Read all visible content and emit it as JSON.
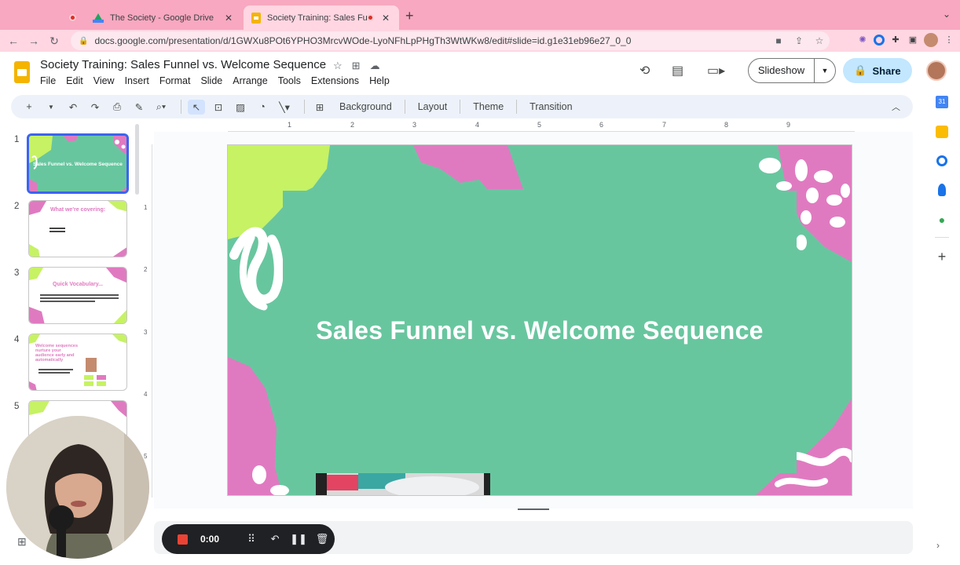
{
  "browser": {
    "tabs": [
      {
        "title": "The Society - Google Drive",
        "icon": "google-drive-icon"
      },
      {
        "title": "Society Training: Sales Fun",
        "icon": "google-slides-icon"
      }
    ],
    "url": "docs.google.com/presentation/d/1GWXu8POt6YPHO3MrcvWOde-LyoNFhLpPHgTh3WtWKw8/edit#slide=id.g1e31eb96e27_0_0"
  },
  "doc": {
    "title": "Society Training: Sales Funnel vs. Welcome Sequence"
  },
  "menu": [
    "File",
    "Edit",
    "View",
    "Insert",
    "Format",
    "Slide",
    "Arrange",
    "Tools",
    "Extensions",
    "Help"
  ],
  "header": {
    "slideshow_label": "Slideshow",
    "share_label": "Share"
  },
  "toolbar": {
    "background_label": "Background",
    "layout_label": "Layout",
    "theme_label": "Theme",
    "transition_label": "Transition"
  },
  "filmstrip": {
    "slides": [
      {
        "number": "1",
        "title": "Sales Funnel vs. Welcome Sequence"
      },
      {
        "number": "2",
        "title": "What we're covering:"
      },
      {
        "number": "3",
        "title": "Quick Vocabulary..."
      },
      {
        "number": "4",
        "title": "Welcome sequences nurture your audience early and automatically"
      },
      {
        "number": "5",
        "title": ""
      }
    ]
  },
  "ruler": {
    "h_ticks": [
      "1",
      "2",
      "3",
      "4",
      "5",
      "6",
      "7",
      "8",
      "9"
    ],
    "v_ticks": [
      "1",
      "2",
      "3",
      "4",
      "5"
    ]
  },
  "slide": {
    "title": "Sales Funnel vs. Welcome Sequence",
    "colors": {
      "background": "#68c69f",
      "lime": "#c6f263",
      "pink": "#e07ac0",
      "white": "#ffffff"
    }
  },
  "recorder": {
    "time": "0:00"
  }
}
